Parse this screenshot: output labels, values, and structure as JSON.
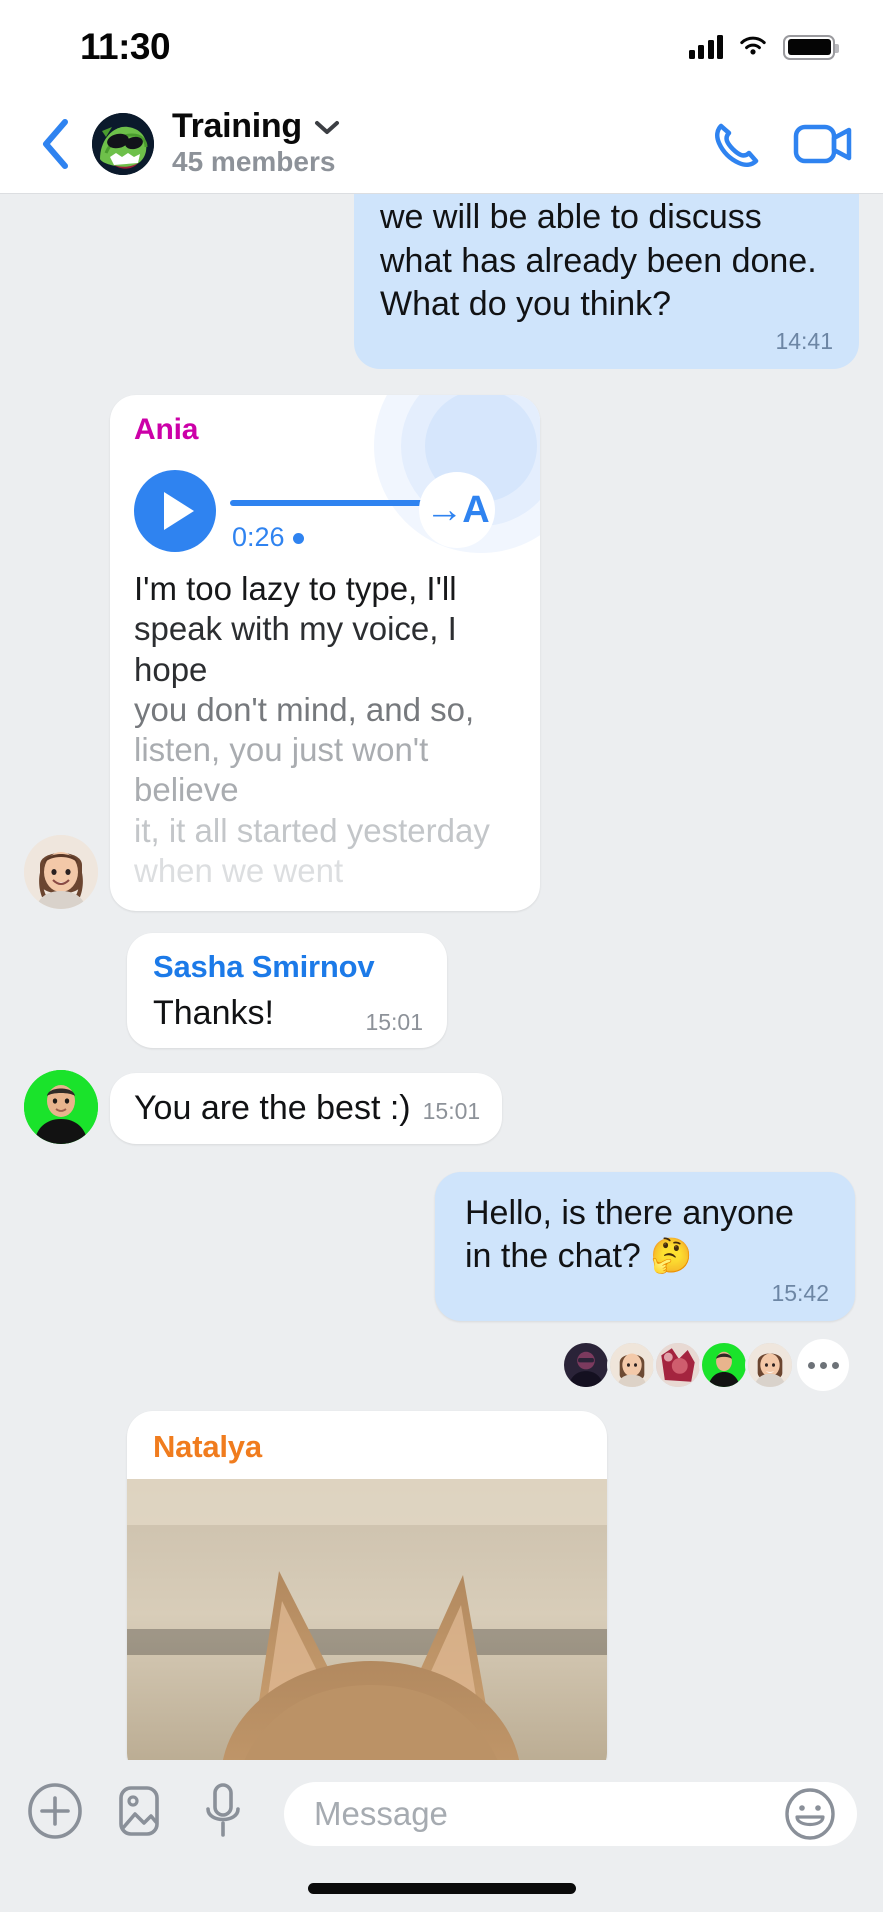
{
  "status_bar": {
    "time": "11:30",
    "signal_icon": "cellular-signal-icon",
    "wifi_icon": "wifi-icon",
    "battery_icon": "battery-icon"
  },
  "header": {
    "back_icon": "back-chevron-icon",
    "avatar_icon": "group-avatar-dinosaur",
    "title": "Training",
    "chevron_icon": "chevron-down-icon",
    "subtitle": "45 members",
    "call_icon": "phone-call-icon",
    "video_icon": "video-call-icon"
  },
  "messages": [
    {
      "id": "m1",
      "direction": "out",
      "clipped_top": true,
      "text": "Plus, by the end of the week we will be able to discuss what has already been done.\nWhat do you think?",
      "time": "14:41"
    },
    {
      "id": "m2",
      "direction": "in",
      "type": "voice_transcript",
      "sender": "Ania",
      "sender_color": "#cc00a8",
      "avatar": "avatar-ania",
      "duration": "0:26",
      "unplayed_dot": true,
      "play_icon": "play-icon",
      "transcribe_icon": "transcribe-to-text-icon",
      "transcribe_label": "→A",
      "transcript_lines": [
        "I'm too lazy to type, I'll",
        "speak with my voice, I hope",
        "you don't mind, and so,",
        "listen, you just won't believe",
        "it, it all started yesterday",
        "when we went"
      ]
    },
    {
      "id": "m3",
      "direction": "in",
      "type": "named_text",
      "sender": "Sasha Smirnov",
      "sender_color": "#1c7ae8",
      "text": "Thanks!",
      "time": "15:01"
    },
    {
      "id": "m4",
      "direction": "in",
      "type": "text_with_avatar",
      "avatar": "avatar-sasha",
      "text": "You are the best :)",
      "time": "15:01"
    },
    {
      "id": "m5",
      "direction": "out",
      "type": "text",
      "text": "Hello, is there anyone in the chat? 🤔",
      "time": "15:42"
    },
    {
      "id": "m6",
      "type": "read_receipts",
      "avatars": [
        "reader-1",
        "reader-2",
        "reader-3",
        "reader-4",
        "reader-5"
      ],
      "more_icon": "more-readers-icon"
    },
    {
      "id": "m7",
      "direction": "in",
      "type": "photo",
      "sender": "Natalya",
      "sender_color": "#f07c1e",
      "photo": "cat-photo"
    }
  ],
  "input_bar": {
    "attach_icon": "plus-attach-icon",
    "gallery_icon": "image-gallery-icon",
    "mic_icon": "microphone-icon",
    "placeholder": "Message",
    "value": "",
    "emoji_icon": "smiley-emoji-icon"
  },
  "colors": {
    "accent_blue": "#2f83f0",
    "outgoing_bubble": "#cfe4fb",
    "incoming_bubble": "#ffffff",
    "chat_background": "#eceef0",
    "muted_text": "#8d9299"
  }
}
